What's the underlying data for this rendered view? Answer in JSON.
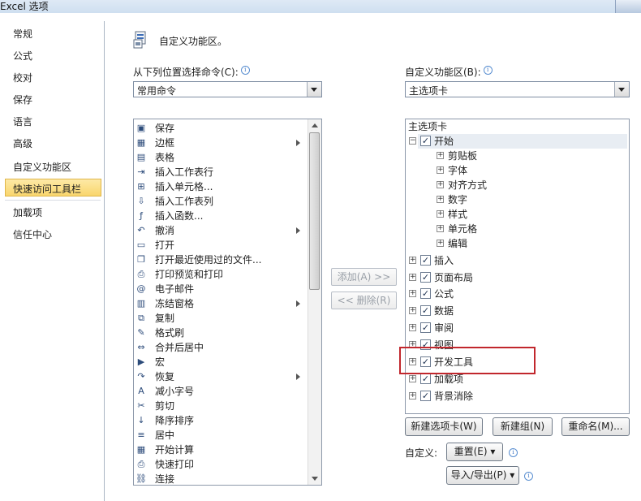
{
  "window": {
    "title": "Excel 选项"
  },
  "nav": {
    "items": [
      "常规",
      "公式",
      "校对",
      "保存",
      "语言",
      "高级",
      "自定义功能区",
      "快速访问工具栏",
      "加载项",
      "信任中心"
    ],
    "selected": "自定义功能区"
  },
  "header": {
    "title": "自定义功能区。"
  },
  "left": {
    "label": "从下列位置选择命令(C):",
    "combo_value": "常用命令",
    "commands": [
      {
        "label": "保存",
        "icon": "save-icon",
        "sub": false
      },
      {
        "label": "边框",
        "icon": "border-icon",
        "sub": true
      },
      {
        "label": "表格",
        "icon": "table-icon",
        "sub": false
      },
      {
        "label": "插入工作表行",
        "icon": "insert-row-icon",
        "sub": false
      },
      {
        "label": "插入单元格...",
        "icon": "insert-cell-icon",
        "sub": false
      },
      {
        "label": "插入工作表列",
        "icon": "insert-column-icon",
        "sub": false
      },
      {
        "label": "插入函数...",
        "icon": "function-icon",
        "sub": false
      },
      {
        "label": "撤消",
        "icon": "undo-icon",
        "sub": true
      },
      {
        "label": "打开",
        "icon": "open-folder-icon",
        "sub": false
      },
      {
        "label": "打开最近使用过的文件...",
        "icon": "recent-file-icon",
        "sub": false
      },
      {
        "label": "打印预览和打印",
        "icon": "print-preview-icon",
        "sub": false
      },
      {
        "label": "电子邮件",
        "icon": "email-icon",
        "sub": false
      },
      {
        "label": "冻结窗格",
        "icon": "freeze-panes-icon",
        "sub": true
      },
      {
        "label": "复制",
        "icon": "copy-icon",
        "sub": false
      },
      {
        "label": "格式刷",
        "icon": "format-painter-icon",
        "sub": false
      },
      {
        "label": "合并后居中",
        "icon": "merge-center-icon",
        "sub": false
      },
      {
        "label": "宏",
        "icon": "macro-icon",
        "sub": false
      },
      {
        "label": "恢复",
        "icon": "redo-icon",
        "sub": true
      },
      {
        "label": "减小字号",
        "icon": "decrease-font-icon",
        "sub": false
      },
      {
        "label": "剪切",
        "icon": "cut-icon",
        "sub": false
      },
      {
        "label": "降序排序",
        "icon": "sort-desc-icon",
        "sub": false
      },
      {
        "label": "居中",
        "icon": "align-center-icon",
        "sub": false
      },
      {
        "label": "开始计算",
        "icon": "calculate-icon",
        "sub": false
      },
      {
        "label": "快速打印",
        "icon": "quick-print-icon",
        "sub": false
      },
      {
        "label": "连接",
        "icon": "connections-icon",
        "sub": false
      }
    ]
  },
  "middle": {
    "add_label": "添加(A) >>",
    "remove_label": "<< 删除(R)"
  },
  "right": {
    "label": "自定义功能区(B):",
    "combo_value": "主选项卡",
    "tree_header": "主选项卡",
    "start_group": "开始",
    "start_children": [
      "剪贴板",
      "字体",
      "对齐方式",
      "数字",
      "样式",
      "单元格",
      "编辑"
    ],
    "tabs": [
      "插入",
      "页面布局",
      "公式",
      "数据",
      "审阅",
      "视图",
      "开发工具",
      "加载项",
      "背景消除"
    ]
  },
  "buttons": {
    "new_tab": "新建选项卡(W)",
    "new_group": "新建组(N)",
    "rename": "重命名(M)...",
    "customize_label": "自定义:",
    "reset": "重置(E) ▾",
    "import_export": "导入/导出(P) ▾"
  },
  "colors": {
    "highlight_border": "#c1272d",
    "nav_selected": "#f9d66d"
  }
}
